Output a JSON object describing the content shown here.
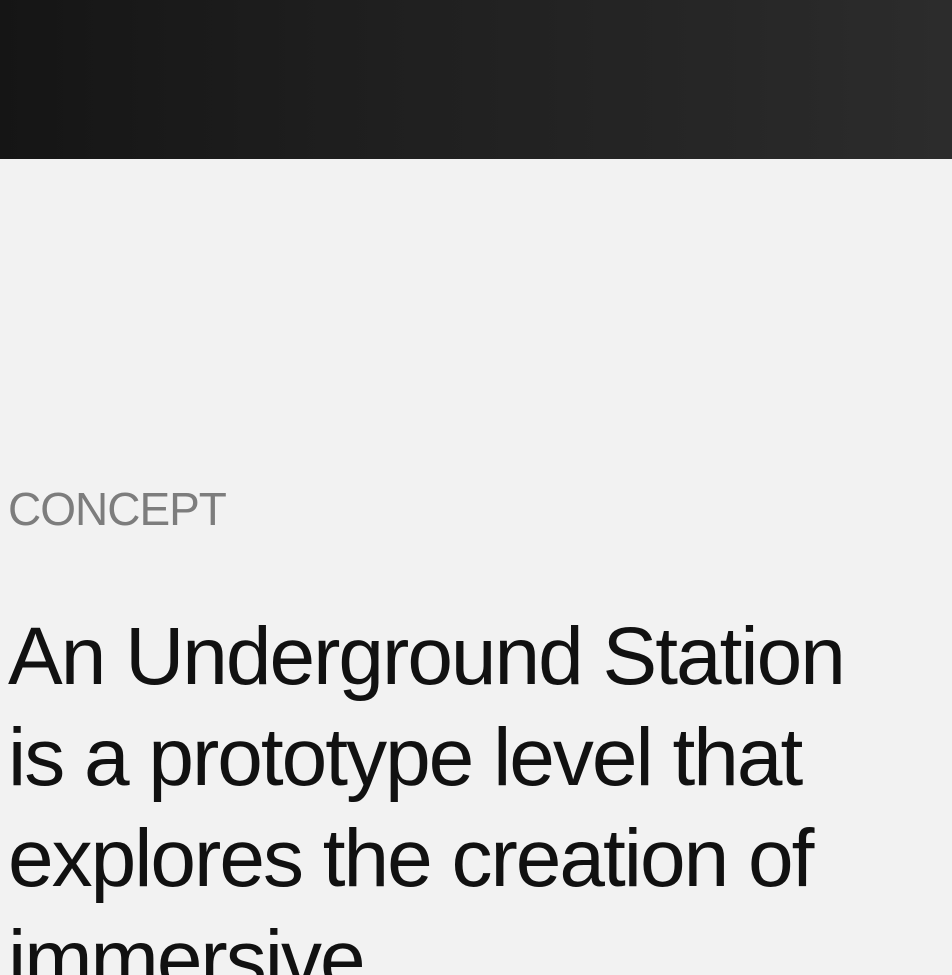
{
  "hero": {
    "background_colors": [
      "#151515",
      "#2c2c2c"
    ]
  },
  "concept": {
    "label": "CONCEPT",
    "description": "An Underground Station is a prototype level that explores the creation of immersive"
  },
  "colors": {
    "page_background": "#f2f2f2",
    "label_text": "#7d7d7d",
    "body_text": "#111111"
  }
}
